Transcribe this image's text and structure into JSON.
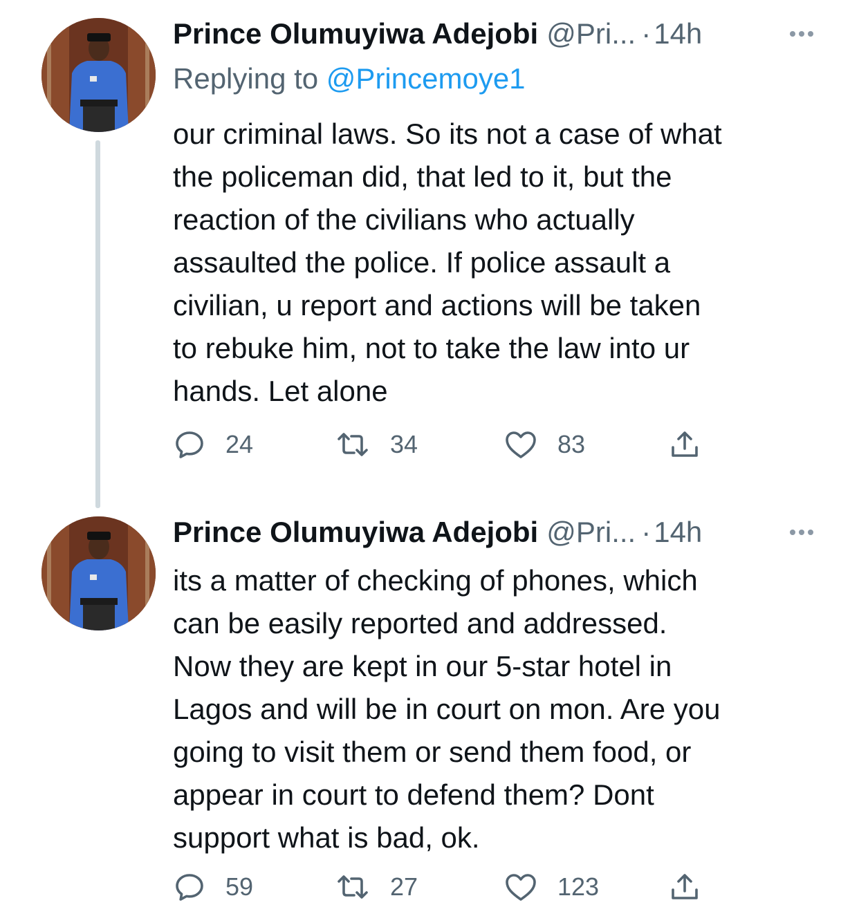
{
  "tweets": [
    {
      "author_name": "Prince Olumuyiwa Adejobi",
      "handle": "@Pri...",
      "separator": "·",
      "time": "14h",
      "replying_prefix": "Replying to ",
      "replying_handle": "@Princemoye1",
      "text": "our criminal laws. So its not a case of what\nthe policeman did, that led to it, but the\nreaction of the civilians who actually\nassaulted the police. If police assault a\ncivilian, u report and actions will be taken\nto rebuke him, not to take the law into ur\nhands. Let alone",
      "replies": "24",
      "retweets": "34",
      "likes": "83"
    },
    {
      "author_name": "Prince Olumuyiwa Adejobi",
      "handle": "@Pri...",
      "separator": "·",
      "time": "14h",
      "text": "its a matter of checking of phones, which\ncan be easily reported and addressed.\nNow they are kept in our 5-star hotel in\nLagos and will be in court on mon. Are you\ngoing to visit them or send them food, or\nappear in court to defend them? Dont\nsupport what is bad,  ok.",
      "replies": "59",
      "retweets": "27",
      "likes": "123"
    }
  ],
  "icons": {
    "reply": "speech-bubble-icon",
    "retweet": "retweet-arrows-icon",
    "like": "heart-outline-icon",
    "share": "share-upload-icon",
    "more": "more-dots-icon"
  },
  "colors": {
    "text": "#0f1419",
    "secondary": "#536471",
    "link": "#1d9bf0",
    "thread_line": "#cfd9de"
  }
}
